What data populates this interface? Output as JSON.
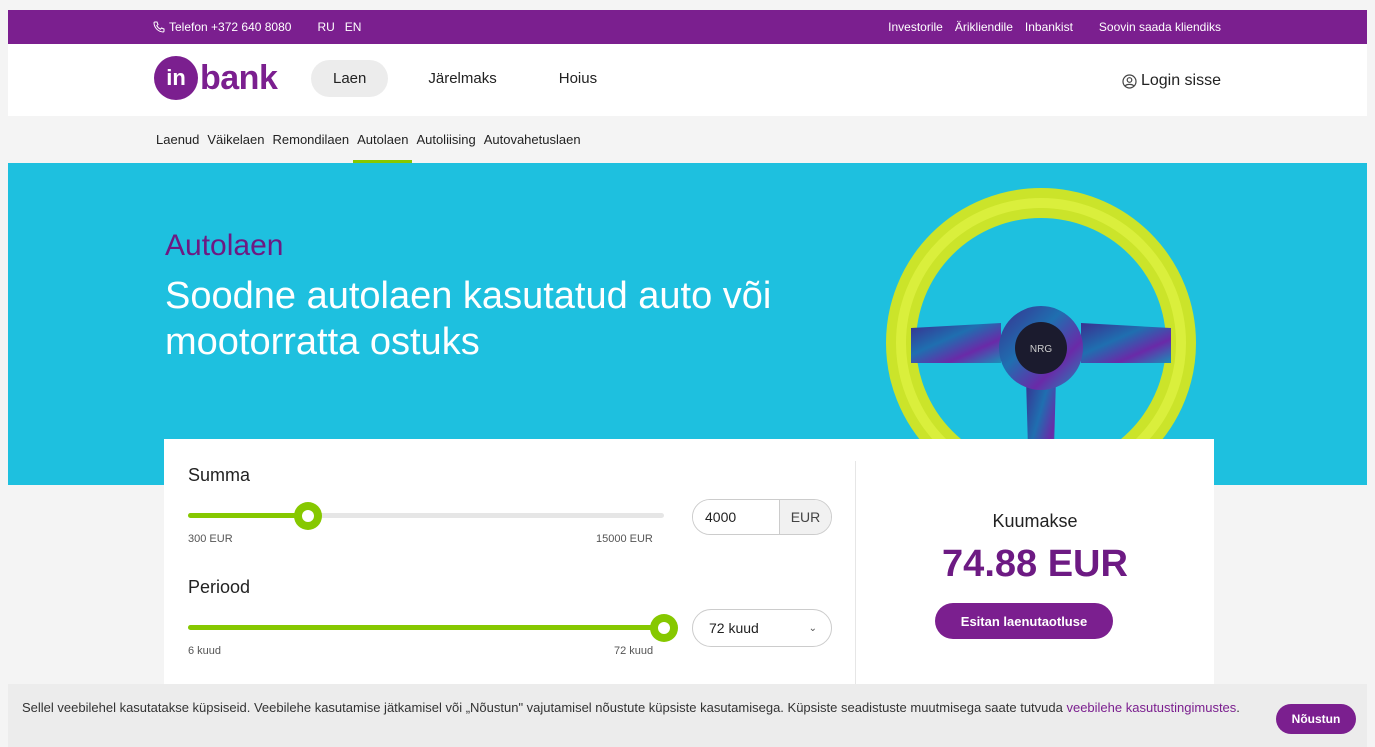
{
  "topbar": {
    "phone": "Telefon +372 640 8080",
    "langs": [
      "RU",
      "EN"
    ],
    "links": [
      "Investorile",
      "Ärikliendile",
      "Inbankist"
    ],
    "become_client": "Soovin saada kliendiks"
  },
  "header": {
    "logo_mark": "in",
    "logo_word": "bank",
    "nav": [
      "Laen",
      "Järelmaks",
      "Hoius"
    ],
    "login": "Login sisse"
  },
  "subnav": {
    "items": [
      "Laenud",
      "Väikelaen",
      "Remondilaen",
      "Autolaen",
      "Autoliising",
      "Autovahetuslaen"
    ],
    "active_index": 3
  },
  "hero": {
    "title": "Autolaen",
    "subtitle": "Soodne autolaen kasutatud auto või mootorratta ostuks",
    "wheel_hub_text": "NRG"
  },
  "calculator": {
    "amount": {
      "label": "Summa",
      "min_label": "300 EUR",
      "max_label": "15000 EUR",
      "min": 300,
      "max": 15000,
      "value": 4000,
      "currency": "EUR"
    },
    "period": {
      "label": "Periood",
      "min_label": "6 kuud",
      "max_label": "72 kuud",
      "min": 6,
      "max": 72,
      "value": 72,
      "selected": "72 kuud"
    },
    "monthly_label": "Kuumakse",
    "monthly_value": "74.88 EUR",
    "apply_label": "Esitan laenutaotluse"
  },
  "cookie": {
    "text": "Sellel veebilehel kasutatakse küpsiseid. Veebilehe kasutamise jätkamisel või „Nõustun\" vajutamisel nõustute küpsiste kasutamisega. Küpsiste seadistuste muutmisega saate tutvuda ",
    "link": "veebilehe kasutustingimustes",
    "end": ".",
    "accept": "Nõustun"
  },
  "colors": {
    "brand_purple": "#7b1f8f",
    "hero_cyan": "#1ec0df",
    "accent_green": "#86c800",
    "wheel_yellow": "#d8f02a"
  }
}
